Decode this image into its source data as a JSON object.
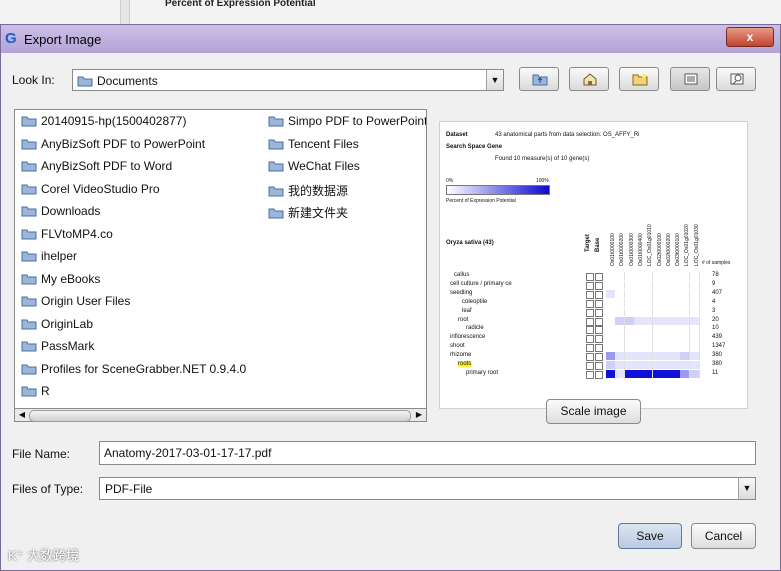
{
  "background_app": {
    "text": "Percent of Expression Potential"
  },
  "dialog": {
    "title": "Export Image",
    "app_glyph": "G",
    "close_label": "x"
  },
  "look_in": {
    "label": "Look In:",
    "value": "Documents",
    "toolbar_icons": [
      "up-folder-icon",
      "home-icon",
      "new-folder-icon",
      "list-view-icon",
      "details-view-icon"
    ]
  },
  "files": {
    "col1": [
      "20140915-hp(1500402877)",
      "AnyBizSoft PDF to PowerPoint",
      "AnyBizSoft PDF to Word",
      "Corel VideoStudio Pro",
      "Downloads",
      "FLVtoMP4.co",
      "ihelper",
      "My eBooks",
      "Origin User Files",
      "OriginLab",
      "PassMark",
      "Profiles for SceneGrabber.NET 0.9.4.0",
      "R"
    ],
    "col2": [
      "Simpo PDF to PowerPoint",
      "Tencent Files",
      "WeChat Files",
      "我的数据源",
      "新建文件夹"
    ]
  },
  "preview": {
    "dataset_label": "Dataset",
    "dataset_value": "43 anatomical parts from data selection: OS_AFFY_Ri",
    "search_label": "Search Space Gene",
    "found_text": "Found 10 measure(s) of 10 gene(s)",
    "scale_min": "0%",
    "scale_max": "100%",
    "legend_caption": "Percent of Expression Potential",
    "organism": "Oryza sativa (43)",
    "col_target": "Target",
    "col_base": "Base",
    "col_count": "# of samples",
    "gene_ids": [
      "Os01t0000100",
      "Os01t0000200",
      "Os01t0000300",
      "Os01t0000400",
      "LOC_Os01g01010",
      "Os02t0000100",
      "Os02t0000200",
      "Os03t0000100",
      "LOC_Os01g01020",
      "LOC_Os01g01030"
    ],
    "rows": [
      {
        "label": "callus",
        "count": "78"
      },
      {
        "label": "cell culture / primary ce",
        "count": "9"
      },
      {
        "label": "seedling",
        "count": "407"
      },
      {
        "label": "coleoptile",
        "count": "4"
      },
      {
        "label": "leaf",
        "count": "3"
      },
      {
        "label": "root",
        "count": "20"
      },
      {
        "label": "radicle",
        "count": "10"
      },
      {
        "label": "inflorescence",
        "count": "439"
      },
      {
        "label": "shoot",
        "count": "1347"
      },
      {
        "label": "rhizome",
        "count": "380"
      },
      {
        "label": "roots",
        "count": "380"
      },
      {
        "label": "primary root",
        "count": "11"
      }
    ]
  },
  "scale_button": "Scale image",
  "file_name": {
    "label": "File Name:",
    "value": "Anatomy-2017-03-01-17-17.pdf"
  },
  "file_type": {
    "label": "Files of Type:",
    "value": "PDF-File"
  },
  "buttons": {
    "save": "Save",
    "cancel": "Cancel"
  },
  "watermark": "K⁺ 大数跨境",
  "colors": {
    "accent": "#b3a4d6",
    "heat_high": "#1010d8",
    "heat_low": "#d6d6f7"
  }
}
